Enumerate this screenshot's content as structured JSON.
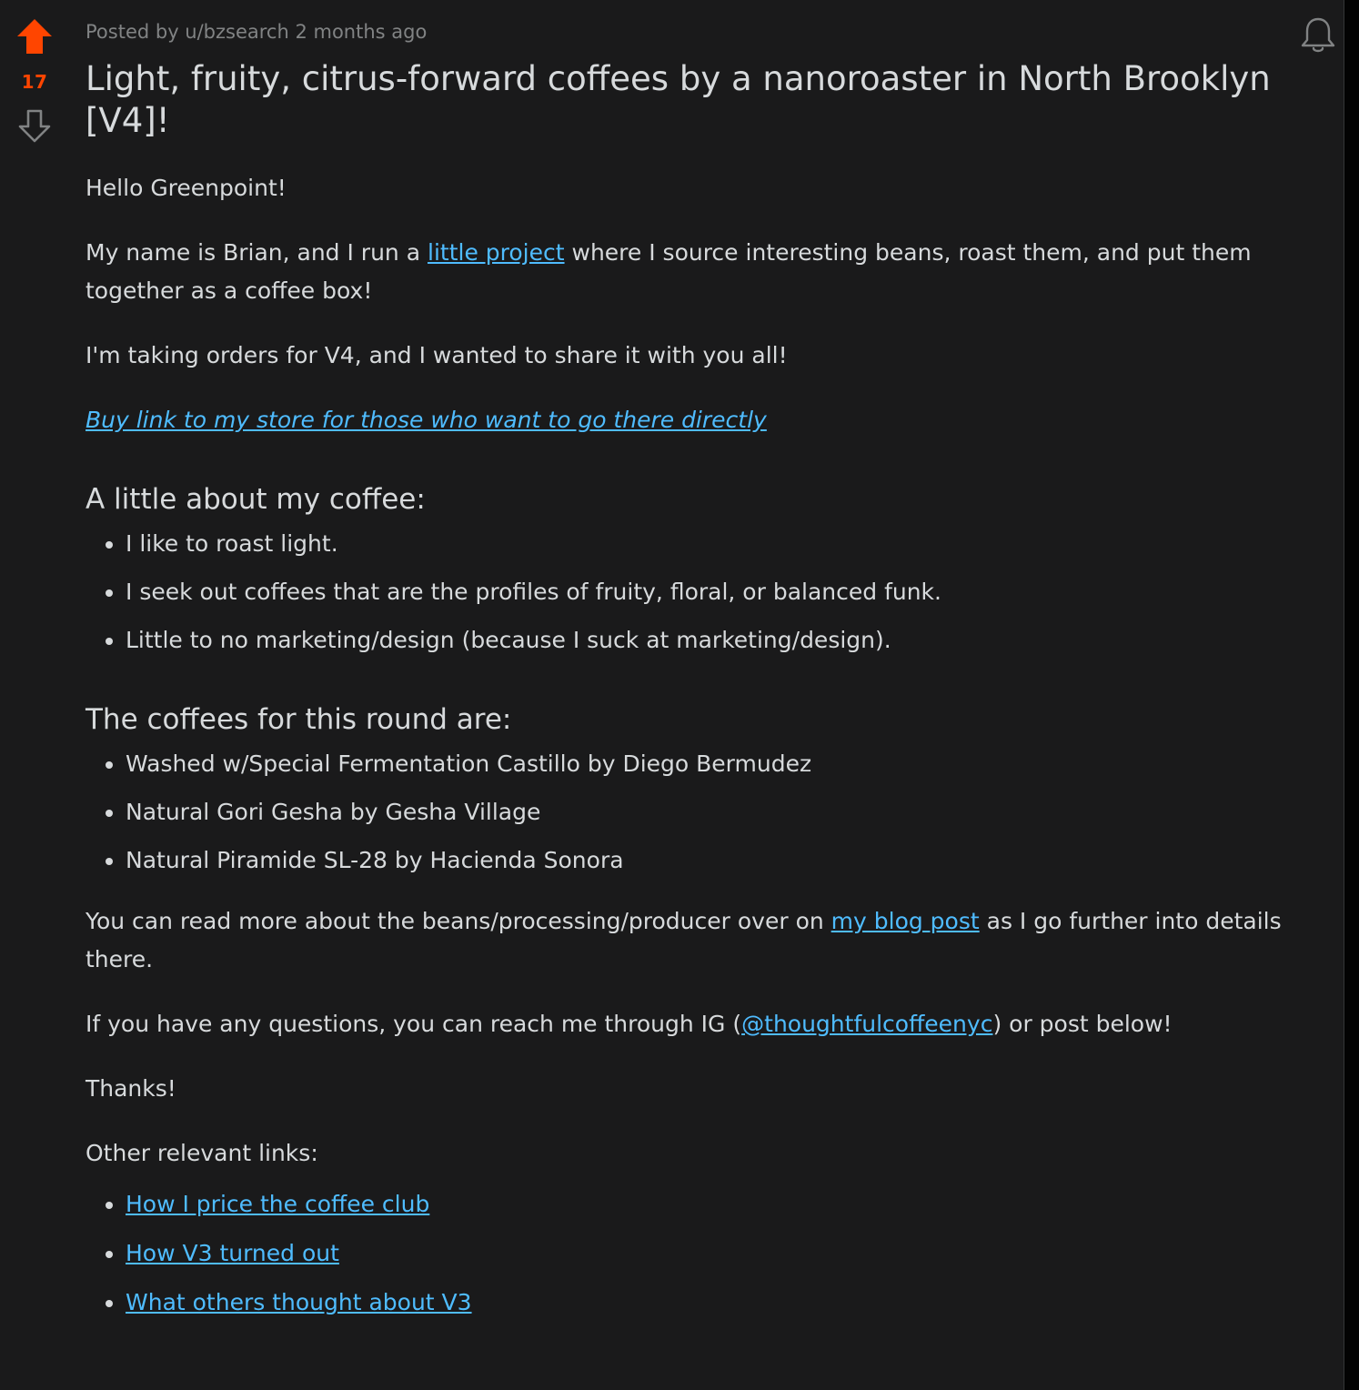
{
  "post": {
    "score": "17",
    "meta": "Posted by u/bzsearch 2 months ago",
    "title": "Light, fruity, citrus-forward coffees by a nanoroaster in North Brooklyn [V4]!",
    "colors": {
      "upvote_active": "#ff4500",
      "link": "#4fbcff",
      "background": "#1a1a1b",
      "text": "#d7dadc",
      "meta": "#818384"
    },
    "icons": {
      "upvote": "upvote-arrow-icon",
      "downvote": "downvote-arrow-icon",
      "notify": "bell-icon"
    }
  },
  "body": {
    "greeting": "Hello Greenpoint!",
    "intro": {
      "before": "My name is Brian, and I run a ",
      "link": "little project",
      "after": " where I source interesting beans, roast them, and put them together as a coffee box!"
    },
    "orders": "I'm taking orders for V4, and I wanted to share it with you all!",
    "buy_link": "Buy link to my store for those who want to go there directly",
    "about_heading": "A little about my coffee:",
    "about_items": [
      "I like to roast light.",
      "I seek out coffees that are the profiles of fruity, floral, or balanced funk.",
      "Little to no marketing/design (because I suck at marketing/design)."
    ],
    "coffees_heading": "The coffees for this round are:",
    "coffees": [
      "Washed w/Special Fermentation Castillo by Diego Bermudez",
      "Natural Gori Gesha by Gesha Village",
      "Natural Piramide SL-28 by Hacienda Sonora"
    ],
    "readmore": {
      "before": "You can read more about the beans/processing/producer over on ",
      "link": "my blog post",
      "after": " as I go further into details there."
    },
    "questions": {
      "before": "If you have any questions, you can reach me through IG (",
      "link": "@thoughtfulcoffeenyc",
      "after": ") or post below!"
    },
    "thanks": "Thanks!",
    "other_links_label": "Other relevant links:",
    "other_links": [
      "How I price the coffee club",
      "How V3 turned out",
      "What others thought about V3"
    ]
  }
}
